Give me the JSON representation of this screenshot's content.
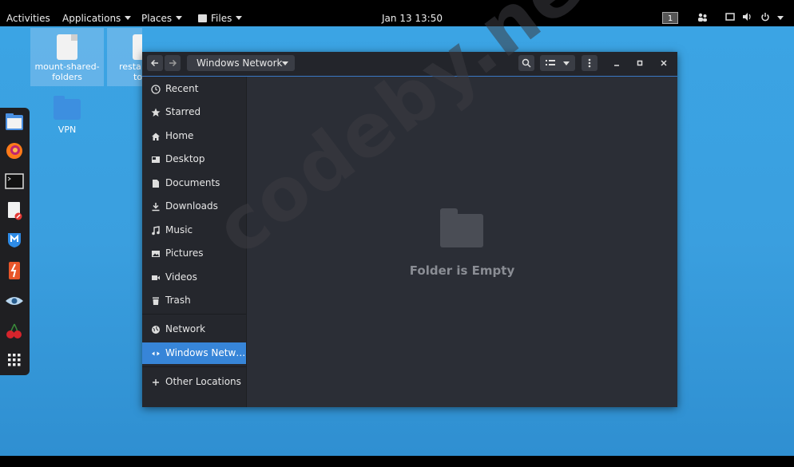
{
  "topbar": {
    "activities": "Activities",
    "applications": "Applications",
    "places": "Places",
    "files": "Files",
    "clock": "Jan 13  13:50",
    "workspace": "1"
  },
  "desktop": {
    "icons": [
      {
        "label": "mount-shared-folders",
        "line1": "mount-shared-",
        "line2": "folders"
      },
      {
        "label": "resta...",
        "line1": "resta",
        "line2": "to"
      },
      {
        "label": "VPN",
        "line1": "VPN",
        "line2": ""
      }
    ]
  },
  "dock": {
    "icons": [
      "files-icon",
      "firefox-icon",
      "terminal-icon",
      "text-editor-icon",
      "malwarebytes-icon",
      "burpsuite-icon",
      "eye-icon",
      "cherrytree-icon",
      "app-grid-icon"
    ]
  },
  "window": {
    "path": "Windows Network",
    "sidebar": [
      {
        "label": "Recent",
        "icon": "clock-icon"
      },
      {
        "label": "Starred",
        "icon": "star-icon"
      },
      {
        "label": "Home",
        "icon": "home-icon"
      },
      {
        "label": "Desktop",
        "icon": "desktop-icon"
      },
      {
        "label": "Documents",
        "icon": "document-icon"
      },
      {
        "label": "Downloads",
        "icon": "download-icon"
      },
      {
        "label": "Music",
        "icon": "music-icon"
      },
      {
        "label": "Pictures",
        "icon": "picture-icon"
      },
      {
        "label": "Videos",
        "icon": "video-icon"
      },
      {
        "label": "Trash",
        "icon": "trash-icon"
      },
      {
        "label": "Network",
        "icon": "network-icon"
      },
      {
        "label": "Windows Netw…",
        "icon": "windows-network-icon"
      },
      {
        "label": "Other Locations",
        "icon": "plus-icon"
      }
    ],
    "empty_message": "Folder is Empty"
  },
  "watermark": "codeby.net",
  "colors": {
    "accent": "#3785d8",
    "desktop_bg": "#3a9fdf",
    "window_bg": "#2b2e36"
  }
}
